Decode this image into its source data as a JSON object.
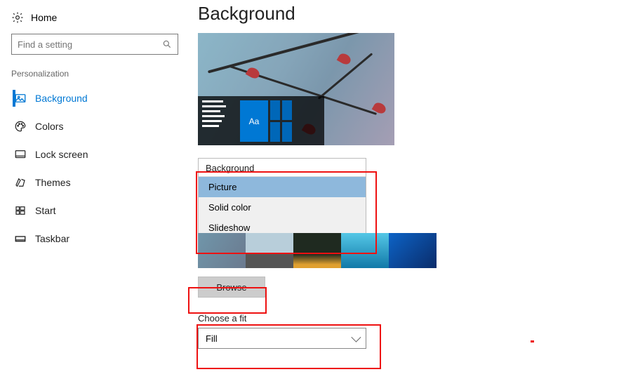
{
  "home_label": "Home",
  "search": {
    "placeholder": "Find a setting"
  },
  "section": "Personalization",
  "nav": [
    {
      "label": "Background"
    },
    {
      "label": "Colors"
    },
    {
      "label": "Lock screen"
    },
    {
      "label": "Themes"
    },
    {
      "label": "Start"
    },
    {
      "label": "Taskbar"
    }
  ],
  "page_title": "Background",
  "preview_tile_text": "Aa",
  "dropdown": {
    "label": "Background",
    "options": [
      "Picture",
      "Solid color",
      "Slideshow"
    ],
    "selected": "Picture"
  },
  "browse_label": "Browse",
  "fit": {
    "label": "Choose a fit",
    "selected": "Fill"
  }
}
